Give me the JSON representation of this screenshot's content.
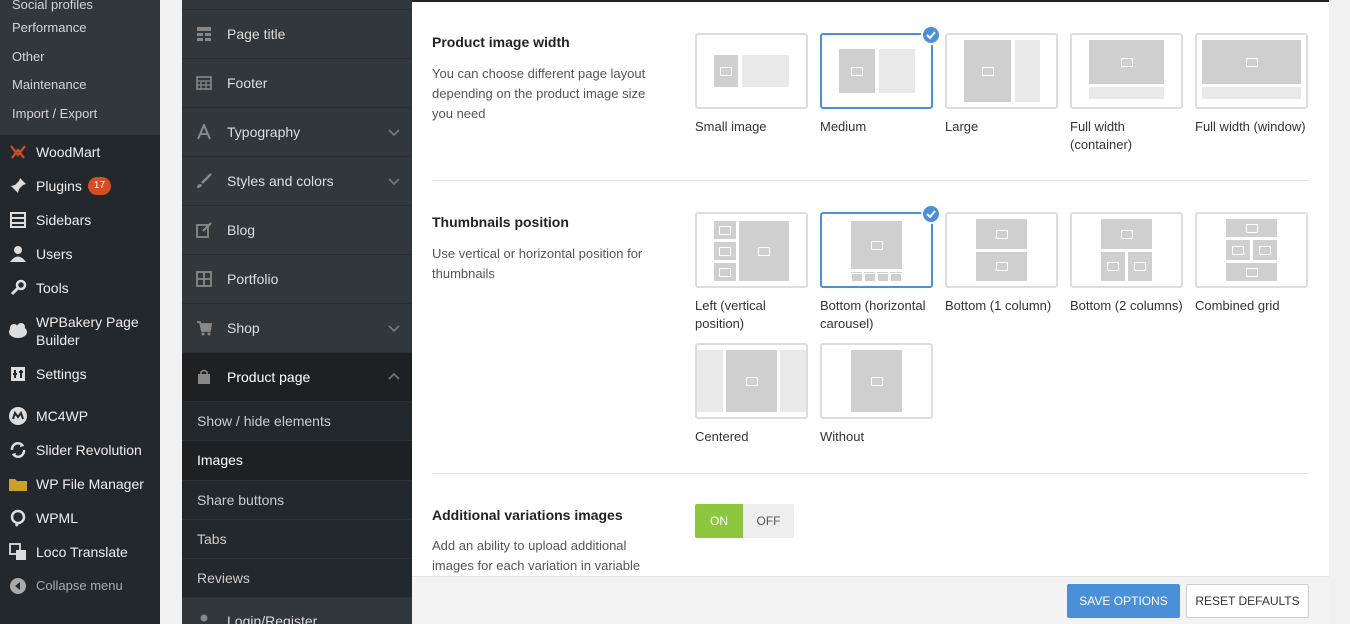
{
  "wp_menu": {
    "submenu": [
      "Social profiles",
      "Performance",
      "Other",
      "Maintenance",
      "Import / Export"
    ],
    "items": [
      {
        "label": "WoodMart",
        "icon": "woodmart-icon"
      },
      {
        "label": "Plugins",
        "icon": "plugins-icon",
        "badge": "17"
      },
      {
        "label": "Sidebars",
        "icon": "sidebars-icon"
      },
      {
        "label": "Users",
        "icon": "users-icon"
      },
      {
        "label": "Tools",
        "icon": "tools-icon"
      },
      {
        "label": "WPBakery Page Builder",
        "icon": "wpbakery-icon"
      },
      {
        "label": "Settings",
        "icon": "settings-icon"
      },
      {
        "label": "MC4WP",
        "icon": "mc4wp-icon"
      },
      {
        "label": "Slider Revolution",
        "icon": "slider-revolution-icon"
      },
      {
        "label": "WP File Manager",
        "icon": "folder-icon"
      },
      {
        "label": "WPML",
        "icon": "wpml-icon"
      },
      {
        "label": "Loco Translate",
        "icon": "translate-icon"
      }
    ],
    "collapse": "Collapse menu"
  },
  "options_menu": {
    "items": [
      {
        "label": "Page title",
        "icon": "page-title-icon"
      },
      {
        "label": "Footer",
        "icon": "footer-icon"
      },
      {
        "label": "Typography",
        "icon": "typography-icon"
      },
      {
        "label": "Styles and colors",
        "icon": "brush-icon"
      },
      {
        "label": "Blog",
        "icon": "blog-icon"
      },
      {
        "label": "Portfolio",
        "icon": "portfolio-icon"
      },
      {
        "label": "Shop",
        "icon": "cart-icon"
      },
      {
        "label": "Product page",
        "icon": "bag-icon"
      }
    ],
    "sub_items": [
      "Show / hide elements",
      "Images",
      "Share buttons",
      "Tabs",
      "Reviews"
    ],
    "next_partial": "Login/Register"
  },
  "product_image_width": {
    "title": "Product image width",
    "desc": "You can choose different page layout depending on the product image size you need",
    "options": [
      "Small image",
      "Medium",
      "Large",
      "Full width (container)",
      "Full width (window)"
    ],
    "selected": "Medium"
  },
  "thumbnails_position": {
    "title": "Thumbnails position",
    "desc": "Use vertical or horizontal position for thumbnails",
    "options": [
      "Left (vertical position)",
      "Bottom (horizontal carousel)",
      "Bottom (1 column)",
      "Bottom (2 columns)",
      "Combined grid",
      "Centered",
      "Without"
    ],
    "selected": "Bottom (horizontal carousel)"
  },
  "variations": {
    "title": "Additional variations images",
    "desc": "Add an ability to upload additional images for each variation in variable",
    "on_label": "ON",
    "off_label": "OFF",
    "state": "ON"
  },
  "footer": {
    "save": "SAVE OPTIONS",
    "reset": "RESET DEFAULTS"
  },
  "colors": {
    "accent": "#4a90d9",
    "toggle_on": "#8dc63f",
    "badge": "#d54e21"
  }
}
